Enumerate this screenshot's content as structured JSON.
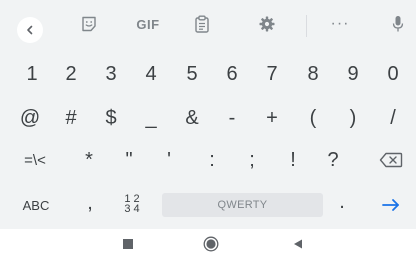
{
  "toolbar": {
    "gif_label": "GIF",
    "more_label": "···"
  },
  "rows": {
    "numbers": [
      "1",
      "2",
      "3",
      "4",
      "5",
      "6",
      "7",
      "8",
      "9",
      "0"
    ],
    "symbols1": [
      "@",
      "#",
      "$",
      "_",
      "&",
      "-",
      "+",
      "(",
      ")",
      "/"
    ],
    "symbols2": [
      "=\\<",
      "*",
      "\"",
      "'",
      ":",
      ";",
      "!",
      "?"
    ],
    "bottom": {
      "abc": "ABC",
      "comma": ",",
      "digits_top": "1 2",
      "digits_bottom": "3 4",
      "space": "QWERTY",
      "period": "."
    }
  },
  "colors": {
    "keyboard_bg": "#f1f3f4",
    "key_text": "#3c4043",
    "icon": "#80868b",
    "accent": "#1a73e8"
  },
  "icons": {
    "back": "chevron-left-icon",
    "emoji": "sticker-emoji-icon",
    "clipboard": "clipboard-icon",
    "settings": "gear-icon",
    "more": "more-icon",
    "mic": "mic-icon",
    "backspace": "backspace-icon",
    "enter": "arrow-right-icon",
    "nav_square": "square-icon",
    "nav_circle": "circle-icon",
    "nav_back": "triangle-back-icon"
  }
}
